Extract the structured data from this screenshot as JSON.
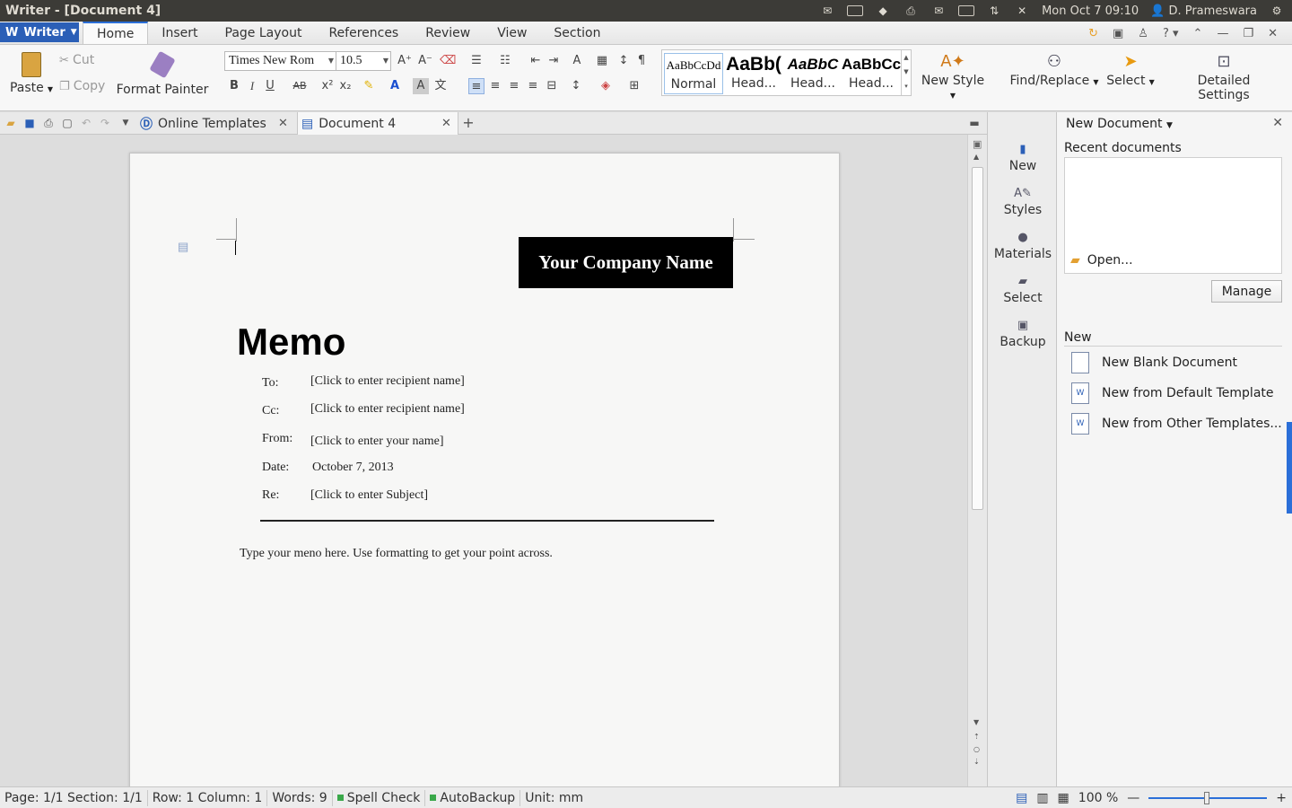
{
  "os": {
    "window_title": "Writer - [Document 4]",
    "datetime": "Mon Oct  7 09:10",
    "user": "D. Prameswara"
  },
  "menu": {
    "app_name": "Writer",
    "tabs": [
      "Home",
      "Insert",
      "Page Layout",
      "References",
      "Review",
      "View",
      "Section"
    ],
    "active_tab": "Home",
    "help_label": "?"
  },
  "ribbon": {
    "paste": "Paste",
    "cut": "Cut",
    "copy": "Copy",
    "format_painter": "Format Painter",
    "font_name": "Times New Rom",
    "font_size": "10.5",
    "bold": "B",
    "italic": "I",
    "underline": "U",
    "strike": "AB",
    "styles": [
      {
        "preview": "AaBbCcDd",
        "name": "Normal"
      },
      {
        "preview": "AaBb(",
        "name": "Head..."
      },
      {
        "preview": "AaBbC",
        "name": "Head..."
      },
      {
        "preview": "AaBbCc",
        "name": "Head..."
      }
    ],
    "new_style": "New Style",
    "find_replace": "Find/Replace",
    "select": "Select",
    "detailed_settings": "Detailed Settings"
  },
  "doc_tabs": {
    "tabs": [
      {
        "label": "Online Templates"
      },
      {
        "label": "Document 4"
      }
    ],
    "add": "+"
  },
  "document": {
    "company_name": "Your Company Name",
    "memo_title": "Memo",
    "fields": [
      {
        "label": "To:",
        "value": "[Click to enter recipient name]"
      },
      {
        "label": "Cc:",
        "value": "[Click to enter recipient name]"
      },
      {
        "label": "From:",
        "value": "[Click to enter your name]"
      },
      {
        "label": "Date:",
        "value": "October 7, 2013"
      },
      {
        "label": "Re:",
        "value": "[Click to enter Subject]"
      }
    ],
    "body": "Type your meno here. Use formatting to get your point across."
  },
  "task_strip": {
    "items": [
      "New",
      "Styles",
      "Materials",
      "Select",
      "Backup"
    ]
  },
  "side_panel": {
    "title": "New Document",
    "recent_heading": "Recent documents",
    "open_label": "Open...",
    "manage_label": "Manage",
    "new_heading": "New",
    "new_items": [
      "New Blank Document",
      "New from Default Template",
      "New from Other Templates..."
    ]
  },
  "status": {
    "page": "Page: 1/1 Section: 1/1",
    "rowcol": "Row: 1 Column: 1",
    "words": "Words: 9",
    "spell_check": "Spell Check",
    "autobackup": "AutoBackup",
    "unit": "Unit: mm",
    "zoom": "100 %"
  },
  "colors": {
    "accent": "#2b6fd8",
    "app_button": "#2b5fb7",
    "os_bar": "#3c3b37",
    "status_green": "#3aa84a"
  }
}
